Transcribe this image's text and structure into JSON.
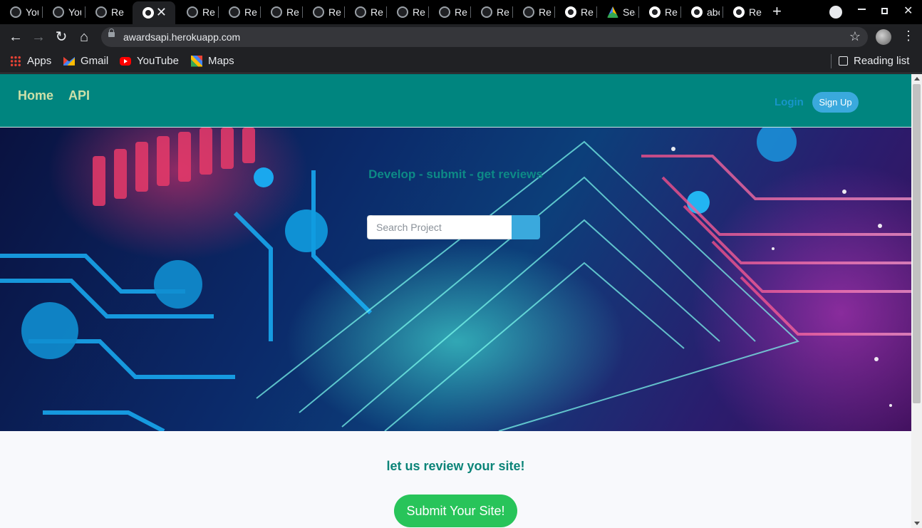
{
  "browser": {
    "tabs": [
      {
        "title": "You",
        "favicon": "github-icon"
      },
      {
        "title": "You",
        "favicon": "github-icon"
      },
      {
        "title": "Re",
        "favicon": "github-icon"
      },
      {
        "title": "",
        "favicon": "globe-icon",
        "active": true
      },
      {
        "title": "Re",
        "favicon": "github-icon"
      },
      {
        "title": "Re",
        "favicon": "github-icon"
      },
      {
        "title": "Re",
        "favicon": "github-icon"
      },
      {
        "title": "Re",
        "favicon": "github-icon"
      },
      {
        "title": "Re",
        "favicon": "github-icon"
      },
      {
        "title": "Re",
        "favicon": "github-icon"
      },
      {
        "title": "Re",
        "favicon": "github-icon"
      },
      {
        "title": "Re",
        "favicon": "github-icon"
      },
      {
        "title": "Re",
        "favicon": "github-icon"
      },
      {
        "title": "Re",
        "favicon": "globe-icon"
      },
      {
        "title": "Sea",
        "favicon": "drive-icon"
      },
      {
        "title": "Re",
        "favicon": "globe-icon"
      },
      {
        "title": "abo",
        "favicon": "globe-icon"
      },
      {
        "title": "Re",
        "favicon": "globe-icon"
      }
    ],
    "url": "awardsapi.herokuapp.com",
    "bookmarks": [
      {
        "label": "Apps",
        "icon": "apps-grid-icon"
      },
      {
        "label": "Gmail",
        "icon": "gmail-icon"
      },
      {
        "label": "YouTube",
        "icon": "youtube-icon"
      },
      {
        "label": "Maps",
        "icon": "maps-icon"
      }
    ],
    "reading_list": "Reading list"
  },
  "site": {
    "nav": {
      "home": "Home",
      "api": "API",
      "login": "Login",
      "signup": "Sign Up"
    },
    "hero": {
      "tagline": "Develop - submit - get reviews",
      "search_placeholder": "Search Project"
    },
    "cta": {
      "heading": "let us review your site!",
      "button": "Submit Your Site!"
    }
  },
  "colors": {
    "nav_bg": "#00857f",
    "nav_link": "#cde0a8",
    "accent_blue": "#3aa9dd",
    "cta_green": "#28c45a",
    "cta_heading": "#0b8478"
  }
}
